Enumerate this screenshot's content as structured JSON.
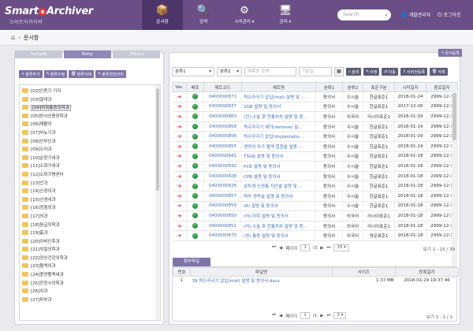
{
  "header": {
    "logo_main": "SmartArchiver",
    "logo_e": "e",
    "logo_sub": "스마트이카이버",
    "nav": [
      {
        "label": "문서함",
        "icon": "📦"
      },
      {
        "label": "검색",
        "icon": "🔍"
      },
      {
        "label": "시석관리 ▾",
        "icon": "⚙"
      },
      {
        "label": "관리 ▾",
        "icon": "🖥"
      }
    ],
    "search_placeholder": "Search",
    "admin_label": "개발관리자",
    "logout_label": "로그아웃"
  },
  "breadcrumb": {
    "home_icon": "⌂",
    "sep": "›",
    "current": "문서함"
  },
  "left": {
    "tabs": [
      "Include",
      "Body",
      "Others"
    ],
    "buttons": [
      "분류추가",
      "분류수정",
      "분류삭제",
      "분류권한관리"
    ],
    "tree_items": [
      "[02]인증기 기자",
      "[03]열대과",
      "[04]마취통증의학과",
      "[05]방사선종양학과",
      "[06]재활의",
      "[07]비뇨기과",
      "[08]산부인과",
      "[09]소아과",
      "[10]순환기내과",
      "[11]소화기내과",
      "[12]소화기병센터",
      "[13]안과",
      "[14]신경외과",
      "[15]신경내과",
      "[16]정형외과",
      "[17]외과",
      "[18]응급의학과",
      "[19]흉과",
      "[20]이비인후과",
      "[21]치질의학과",
      "[22]정신건강의학과",
      "[23]혈액외과",
      "[24]종양혈액내과",
      "[25]진정시의학과",
      "[26]치과",
      "[27]피부과"
    ],
    "selected_index": 2
  },
  "right": {
    "sign_button": "문서등록",
    "filter": {
      "cat1": "분류1",
      "cat2": "분류2",
      "keyword_placeholder": "제목명 검색",
      "date_placeholder": "기준일",
      "buttons": [
        "검색",
        "수정",
        "이동",
        "서버전등록",
        "삭제"
      ]
    },
    "columns": [
      "Ver.",
      "배포",
      "제트코드",
      "제트명",
      "분류1",
      "분류2",
      "표준구분",
      "시작일자",
      "종료일자"
    ],
    "rows": [
      [
        "0400000871",
        "척수자극기 삽입(trial) 설명 및 …",
        "동의서",
        "수시술",
        "한글표준1",
        "2018-01-24",
        "2999-12-3"
      ],
      [
        "0400000837",
        "SGB 설명 및 동의서",
        "동의서",
        "수시술",
        "한글표준1",
        "2017-12-26",
        "2999-12-3"
      ],
      [
        "0400000863",
        "(전) 수술 후 전통처치 설명 및 동…",
        "동의서",
        "외국어",
        "러시아표준1",
        "2018-01-19",
        "2999-12-3"
      ],
      [
        "0400000858",
        "척수자극기 제거(remove) 설…",
        "동의서",
        "수시술",
        "한글표준1",
        "2018-01-19",
        "2999-12-3"
      ],
      [
        "0400000856",
        "척수자극기 삽입(implantatio…",
        "동의서",
        "수시술",
        "한글표준1",
        "2018-01-19",
        "2999-12-3"
      ],
      [
        "0400000855",
        "경막외 자가 혈액 첩합술 설명 …",
        "동의서",
        "수시술",
        "한글표준1",
        "2018-01-19",
        "2999-12-3"
      ],
      [
        "0400000842",
        "TSGB 설명 및 동의서",
        "동의서",
        "수시술",
        "한글표준1",
        "2018-01-18",
        "2999-12-3"
      ],
      [
        "0400000830",
        "PCB 설명 및 동의서",
        "동의서",
        "수시술",
        "한글표준1",
        "2018-01-18",
        "2999-12-3"
      ],
      [
        "0400000828",
        "CPB 설명 및 동의서",
        "동의서",
        "수시술",
        "한글표준1",
        "2018-01-18",
        "2999-12-3"
      ],
      [
        "0400000826",
        "삼차계 신경총 지단술 설명 및 …",
        "동의서",
        "수시술",
        "한글표준1",
        "2018-01-18",
        "2999-12-3"
      ],
      [
        "0400000857",
        "척추 경막술 설명 및 동의서",
        "동의서",
        "수시술",
        "한글표준1",
        "2018-01-18",
        "2999-12-3"
      ],
      [
        "0400000859",
        "(R) 설명 및 동의서",
        "동의서",
        "수시술",
        "한글표준1",
        "2018-01-18",
        "2999-12-3"
      ],
      [
        "0400000850",
        "(러) 마취 설명 및 동의서",
        "동의서",
        "외국어",
        "러시아표준1",
        "2018-01-18",
        "2999-12-3"
      ],
      [
        "0400000851",
        "(러) 수술 후 전통처치 설명 및 동…",
        "동의서",
        "외국어",
        "러시아표준1",
        "2018-01-18",
        "2999-12-3"
      ],
      [
        "0400000870",
        "(영) 통증 설명 및 동의서",
        "동의서",
        "외국어",
        "영문표준1",
        "2018-01-18",
        "2999-12-3"
      ]
    ],
    "pager": {
      "first": "⏮",
      "prev": "◀",
      "page_label": "페이지",
      "page": "1",
      "total": "/3",
      "next": "▶",
      "last": "⏭",
      "size": "15",
      "count": "보기 1 - 15 / 39"
    },
    "attach": {
      "tab": "첨부파일",
      "columns": [
        "번호",
        "파일명",
        "사이즈",
        "등록일자"
      ],
      "rows": [
        [
          "1",
          "39 척수자극기 삽입(trial) 설명 및 동의서.docx",
          "1.37 MB",
          "2018-01-24 19:37:46"
        ]
      ],
      "page_label": "페이지",
      "page": "1",
      "total": "/1",
      "size": "3",
      "count": "보기 1 - 1 / 1"
    }
  }
}
